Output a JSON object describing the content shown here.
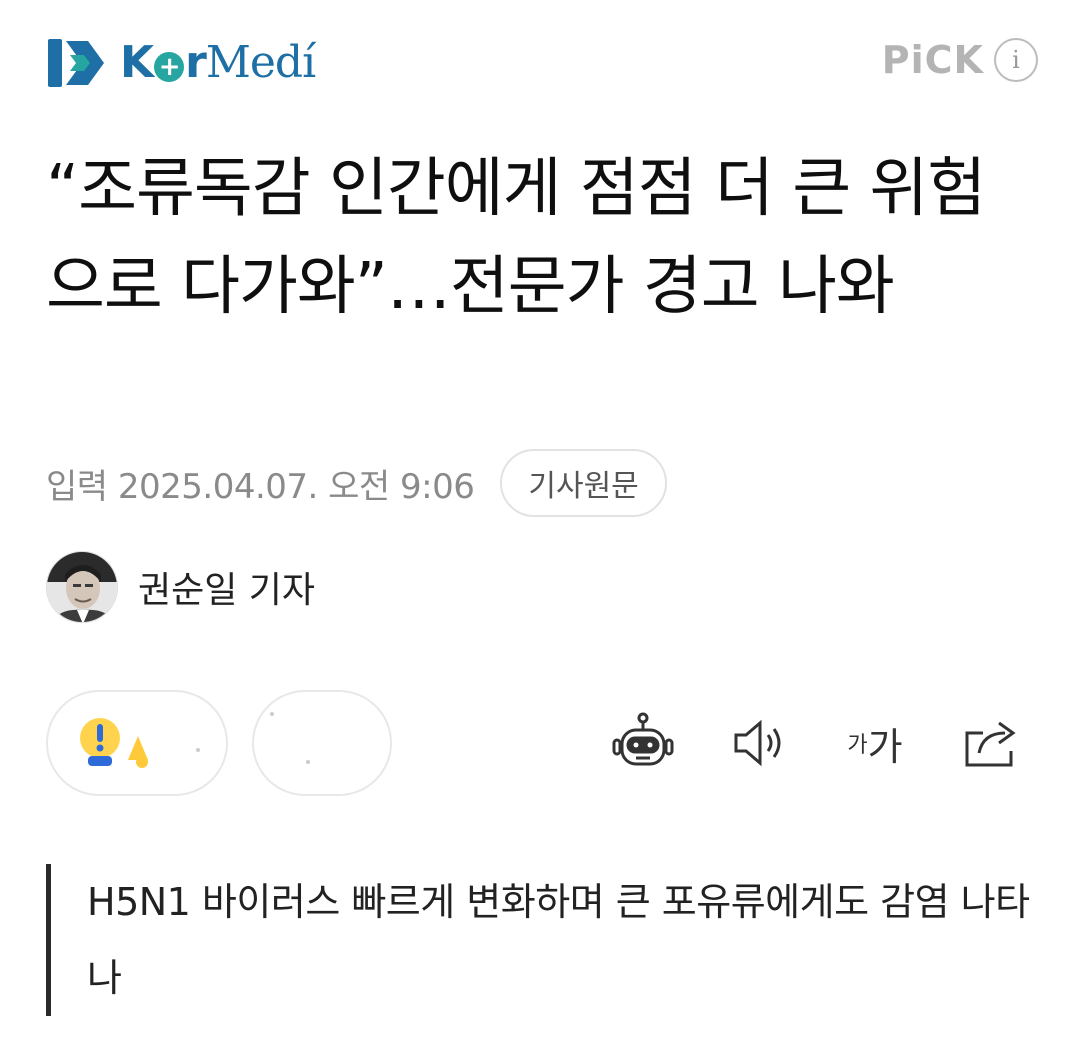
{
  "header": {
    "logo_text": "KorMedi",
    "pick_label": "PiCK",
    "info_label": "i"
  },
  "article": {
    "title": "“조류독감 인간에게 점점 더 큰 위험으로 다가와”…전문가 경고 나와",
    "date": "입력 2025.04.07. 오전 9:06",
    "source_button": "기사원문",
    "reporter": "권순일 기자",
    "summary": "H5N1 바이러스 빠르게 변화하며 큰 포유류에게도 감염 나타나"
  },
  "toolbar": {
    "font_small": "가",
    "font_large": "가",
    "icons": [
      "robot-icon",
      "speaker-icon",
      "font-size-icon",
      "share-icon"
    ]
  },
  "colors": {
    "brand_blue": "#1d6fa5",
    "brand_teal": "#27a5a0",
    "pick_gray": "#b4b4b4"
  }
}
